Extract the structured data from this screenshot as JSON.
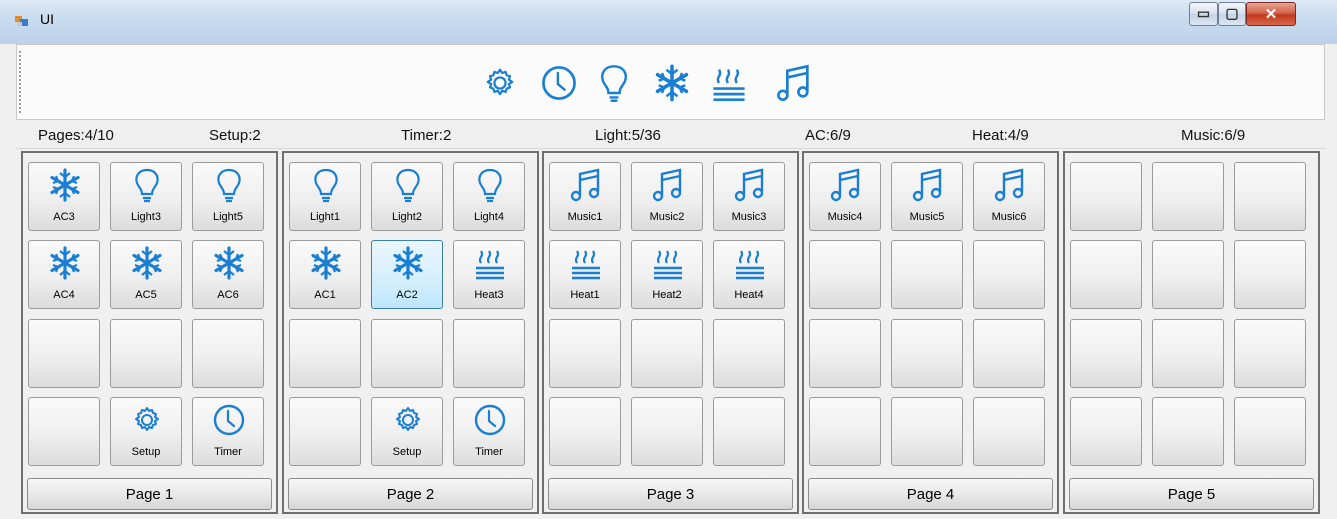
{
  "window": {
    "title": "UI",
    "min_glyph": "▭",
    "max_glyph": "▢",
    "close_glyph": "✕"
  },
  "toolbar": {
    "icons": [
      "gear-icon",
      "clock-icon",
      "bulb-icon",
      "snowflake-icon",
      "heat-icon",
      "music-icon"
    ]
  },
  "status": {
    "pages": "Pages:4/10",
    "setup": "Setup:2",
    "timer": "Timer:2",
    "light": "Light:5/36",
    "ac": "AC:6/9",
    "heat": "Heat:4/9",
    "music": "Music:6/9"
  },
  "colors": {
    "icon": "#1a7fd4",
    "selected": "#bee6fd"
  },
  "pages": [
    {
      "label": "Page 1",
      "tiles": [
        {
          "icon": "snowflake",
          "label": "AC3"
        },
        {
          "icon": "bulb",
          "label": "Light3"
        },
        {
          "icon": "bulb",
          "label": "Light5"
        },
        {
          "icon": "snowflake",
          "label": "AC4"
        },
        {
          "icon": "snowflake",
          "label": "AC5"
        },
        {
          "icon": "snowflake",
          "label": "AC6"
        },
        {
          "icon": "",
          "label": ""
        },
        {
          "icon": "",
          "label": ""
        },
        {
          "icon": "",
          "label": ""
        },
        {
          "icon": "",
          "label": ""
        },
        {
          "icon": "gear",
          "label": "Setup"
        },
        {
          "icon": "clock",
          "label": "Timer"
        }
      ]
    },
    {
      "label": "Page 2",
      "tiles": [
        {
          "icon": "bulb",
          "label": "Light1"
        },
        {
          "icon": "bulb",
          "label": "Light2"
        },
        {
          "icon": "bulb",
          "label": "Light4"
        },
        {
          "icon": "snowflake",
          "label": "AC1"
        },
        {
          "icon": "snowflake",
          "label": "AC2",
          "selected": true
        },
        {
          "icon": "heat",
          "label": "Heat3"
        },
        {
          "icon": "",
          "label": ""
        },
        {
          "icon": "",
          "label": ""
        },
        {
          "icon": "",
          "label": ""
        },
        {
          "icon": "",
          "label": ""
        },
        {
          "icon": "gear",
          "label": "Setup"
        },
        {
          "icon": "clock",
          "label": "Timer"
        }
      ]
    },
    {
      "label": "Page 3",
      "tiles": [
        {
          "icon": "music",
          "label": "Music1"
        },
        {
          "icon": "music",
          "label": "Music2"
        },
        {
          "icon": "music",
          "label": "Music3"
        },
        {
          "icon": "heat",
          "label": "Heat1"
        },
        {
          "icon": "heat",
          "label": "Heat2"
        },
        {
          "icon": "heat",
          "label": "Heat4"
        },
        {
          "icon": "",
          "label": ""
        },
        {
          "icon": "",
          "label": ""
        },
        {
          "icon": "",
          "label": ""
        },
        {
          "icon": "",
          "label": ""
        },
        {
          "icon": "",
          "label": ""
        },
        {
          "icon": "",
          "label": ""
        }
      ]
    },
    {
      "label": "Page 4",
      "tiles": [
        {
          "icon": "music",
          "label": "Music4"
        },
        {
          "icon": "music",
          "label": "Music5"
        },
        {
          "icon": "music",
          "label": "Music6"
        },
        {
          "icon": "",
          "label": ""
        },
        {
          "icon": "",
          "label": ""
        },
        {
          "icon": "",
          "label": ""
        },
        {
          "icon": "",
          "label": ""
        },
        {
          "icon": "",
          "label": ""
        },
        {
          "icon": "",
          "label": ""
        },
        {
          "icon": "",
          "label": ""
        },
        {
          "icon": "",
          "label": ""
        },
        {
          "icon": "",
          "label": ""
        }
      ]
    },
    {
      "label": "Page 5",
      "tiles": [
        {
          "icon": "",
          "label": ""
        },
        {
          "icon": "",
          "label": ""
        },
        {
          "icon": "",
          "label": ""
        },
        {
          "icon": "",
          "label": ""
        },
        {
          "icon": "",
          "label": ""
        },
        {
          "icon": "",
          "label": ""
        },
        {
          "icon": "",
          "label": ""
        },
        {
          "icon": "",
          "label": ""
        },
        {
          "icon": "",
          "label": ""
        },
        {
          "icon": "",
          "label": ""
        },
        {
          "icon": "",
          "label": ""
        },
        {
          "icon": "",
          "label": ""
        }
      ]
    }
  ]
}
